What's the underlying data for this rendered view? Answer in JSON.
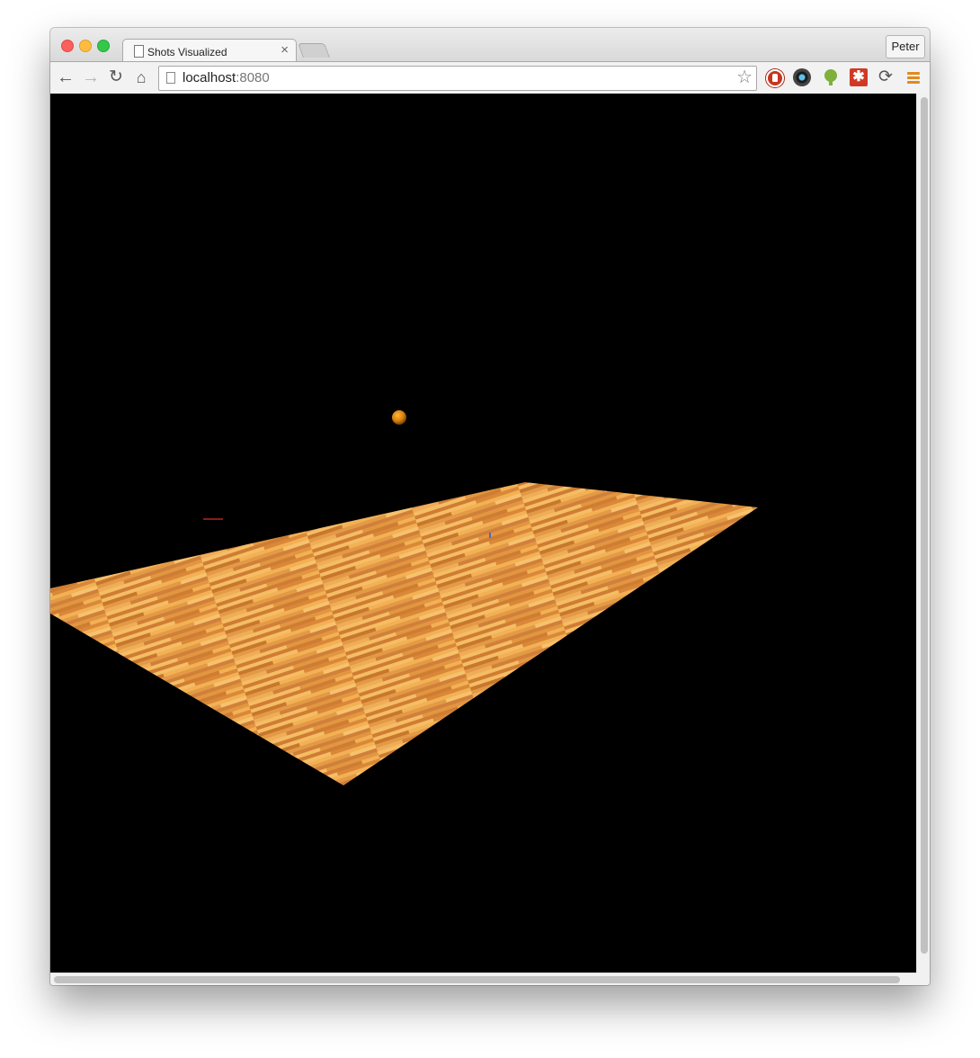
{
  "window": {
    "tab": {
      "title": "Shots Visualized",
      "close_glyph": "×"
    },
    "profile_name": "Peter"
  },
  "toolbar": {
    "back_glyph": "←",
    "forward_glyph": "→",
    "reload_glyph": "↻",
    "home_glyph": "⌂",
    "url_host": "localhost",
    "url_port": ":8080",
    "star_glyph": "☆",
    "extensions": [
      "adblock-icon",
      "lens-icon",
      "lightbulb-icon",
      "red-square-icon",
      "sync-icon",
      "chrome-menu-icon"
    ]
  },
  "scene": {
    "background": "#000000",
    "court_colors": [
      "#f3b055",
      "#d98838",
      "#c8772e",
      "#f5bd64",
      "#e39a45"
    ],
    "ball_color": "#e08a10"
  }
}
